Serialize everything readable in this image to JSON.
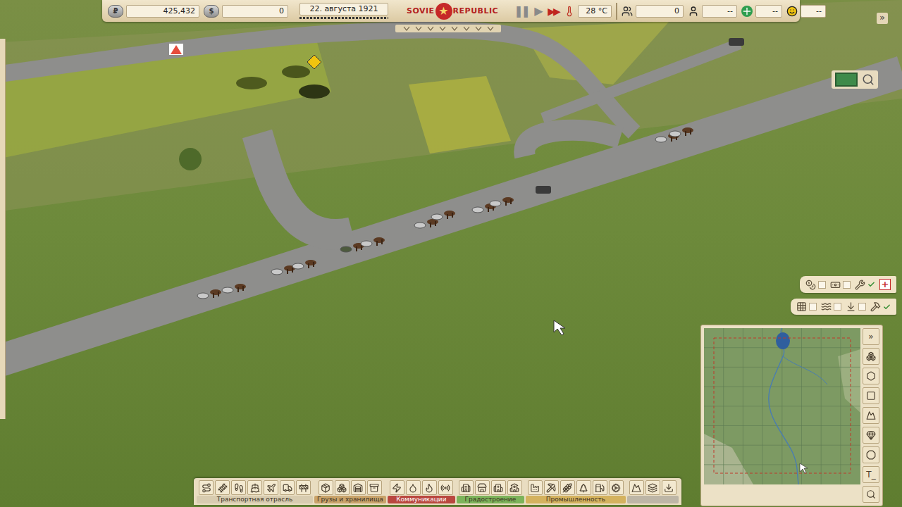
{
  "top_bar": {
    "money": {
      "icon": "₽",
      "value": "425,432"
    },
    "dollars": {
      "icon": "$",
      "value": "0"
    },
    "date": "22. августа 1921",
    "logo": {
      "left": "SOVIE",
      "star": "★",
      "right": "REPUBLIC"
    },
    "speed": [
      {
        "label": "❚❚",
        "selected": false
      },
      {
        "label": "▶",
        "selected": false
      },
      {
        "label": "▶▶",
        "selected": true
      }
    ],
    "temperature": "28 °C",
    "population": "0",
    "workers": "--",
    "health": "--",
    "happiness": "--"
  },
  "corner_button": "»",
  "view_panel": {
    "map_mode_on": true
  },
  "filters": {
    "rows": [
      [
        {
          "checked": false
        },
        {
          "checked": false
        },
        {
          "checked": true
        }
      ],
      [
        {
          "checked": false
        },
        {
          "checked": false
        },
        {
          "checked": false
        },
        {
          "checked": true
        }
      ]
    ],
    "add_button": "+"
  },
  "minimap": {
    "expand": "»",
    "text_button": "T_"
  },
  "toolbar": [
    {
      "label": "Транспортная отрасль",
      "tools": 7,
      "color": "#d8ccb0"
    },
    {
      "label": "Грузы и хранилища",
      "tools": 4,
      "color": "#c9a36a"
    },
    {
      "label": "Коммуникации",
      "tools": 4,
      "color": "#b9473f"
    },
    {
      "label": "Градостроение",
      "tools": 4,
      "color": "#7cb35a"
    },
    {
      "label": "Промышленность",
      "tools": 6,
      "color": "#d4b25e"
    },
    {
      "label": "",
      "tools": 3,
      "color": "#bdb6a6"
    }
  ]
}
